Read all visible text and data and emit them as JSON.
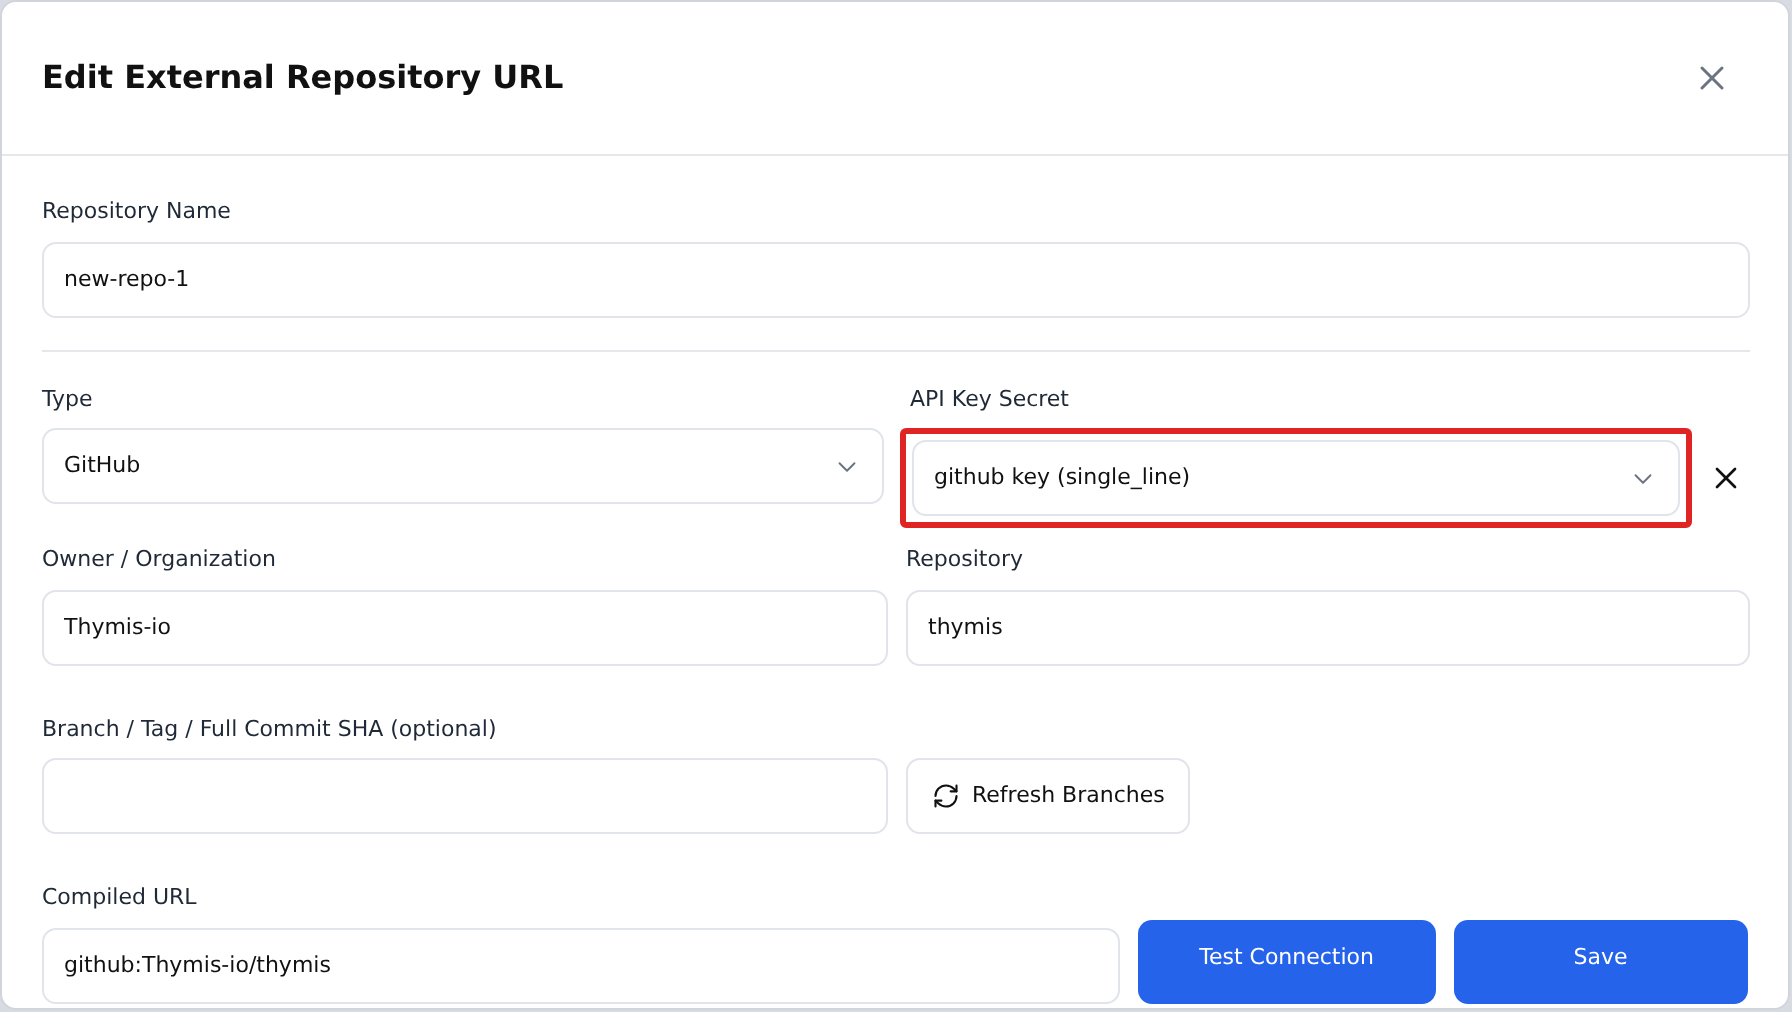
{
  "dialog": {
    "title": "Edit External Repository URL"
  },
  "repository_name": {
    "label": "Repository Name",
    "value": "new-repo-1"
  },
  "type": {
    "label": "Type",
    "value": "GitHub"
  },
  "api_key_secret": {
    "label": "API Key Secret",
    "value": "github key (single_line)",
    "highlighted": true
  },
  "owner": {
    "label": "Owner / Organization",
    "value": "Thymis-io"
  },
  "repository": {
    "label": "Repository",
    "value": "thymis"
  },
  "branch": {
    "label": "Branch / Tag / Full Commit SHA (optional)",
    "refresh_button": "Refresh Branches"
  },
  "compiled_url": {
    "label": "Compiled URL",
    "value": "github:Thymis-io/thymis"
  },
  "buttons": [
    "Test Connection",
    "Save"
  ]
}
